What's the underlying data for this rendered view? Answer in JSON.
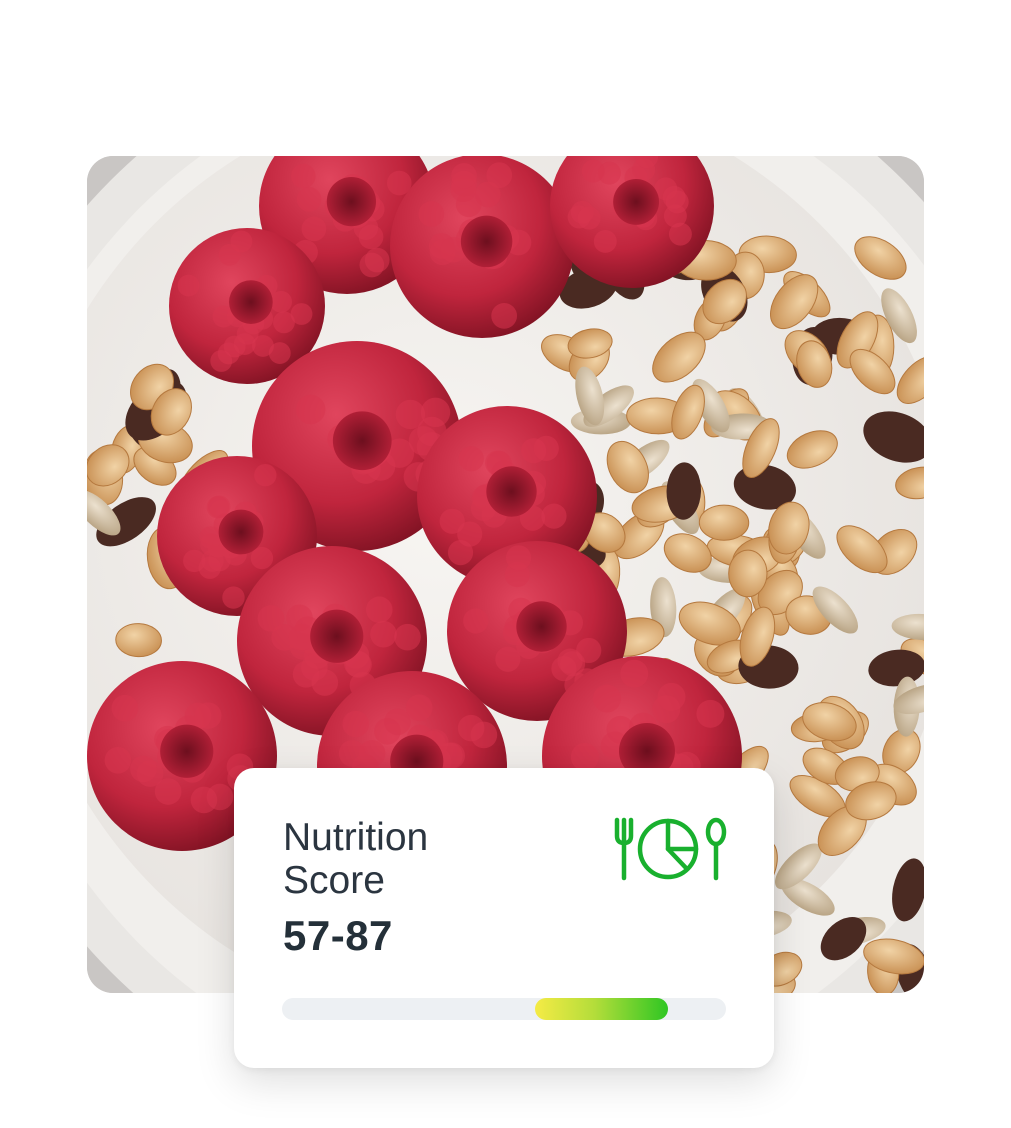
{
  "photo": {
    "subject": "Bowl of raspberries with muesli and milk",
    "colors": {
      "milk": "#f4f1ee",
      "raspberry": "#c0253d",
      "raspberry_dark": "#8e1528",
      "oats": "#d8aa74",
      "raisin": "#4a2a22",
      "backdrop": "#c9c6c4"
    }
  },
  "score_card": {
    "title": "Nutrition Score",
    "value": "57-87",
    "range": {
      "min": 0,
      "max": 100,
      "low": 57,
      "high": 87
    },
    "icon": "fork-pie-chart-spoon-icon",
    "accent": "#19b02e"
  }
}
